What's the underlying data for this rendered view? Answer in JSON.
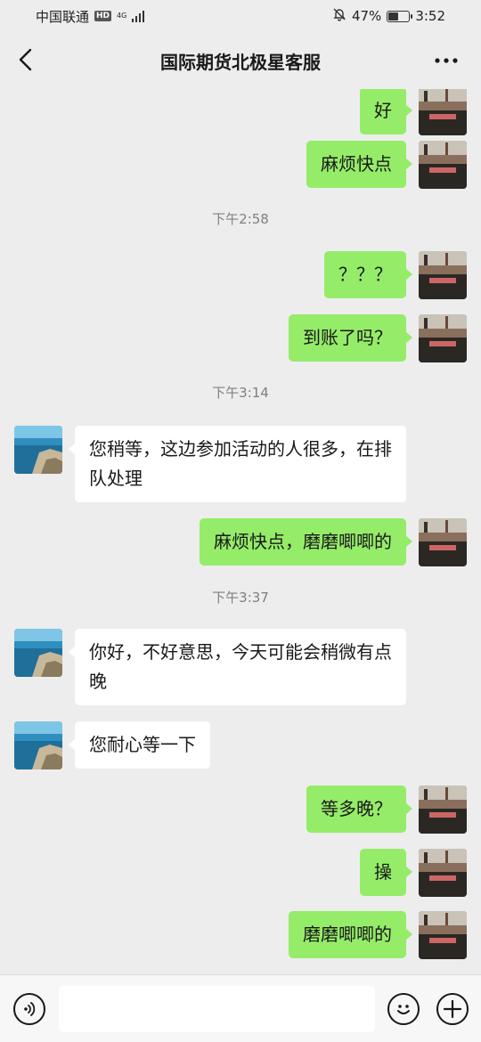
{
  "status_bar": {
    "carrier": "中国联通",
    "hd_badge": "HD",
    "network": "4G",
    "battery_percent": "47%",
    "battery_level": 0.47,
    "time": "3:52",
    "icons": [
      "mute-bell-icon",
      "signal-icon",
      "battery-icon"
    ]
  },
  "nav": {
    "title": "国际期货北极星客服",
    "back_icon": "chevron-left-icon",
    "more_icon": "more-dots-icon"
  },
  "chat": {
    "messages": [
      {
        "dir": "out",
        "text": "好"
      },
      {
        "dir": "out",
        "text": "麻烦快点"
      },
      {
        "type": "time",
        "text": "下午2:58"
      },
      {
        "dir": "out",
        "text": "？？？"
      },
      {
        "dir": "out",
        "text": "到账了吗？"
      },
      {
        "type": "time",
        "text": "下午3:14"
      },
      {
        "dir": "in",
        "text": "您稍等，这边参加活动的人很多，在排队处理"
      },
      {
        "dir": "out",
        "text": "麻烦快点，磨磨唧唧的"
      },
      {
        "type": "time",
        "text": "下午3:37"
      },
      {
        "dir": "in",
        "text": "你好，不好意思，今天可能会稍微有点晚"
      },
      {
        "dir": "in",
        "text": "您耐心等一下"
      },
      {
        "dir": "out",
        "text": "等多晚？"
      },
      {
        "dir": "out",
        "text": "操"
      },
      {
        "dir": "out",
        "text": "磨磨唧唧的"
      }
    ]
  },
  "input_bar": {
    "input_value": "",
    "voice_icon": "voice-icon",
    "emoji_icon": "emoji-icon",
    "plus_icon": "plus-icon"
  },
  "colors": {
    "background": "#ededed",
    "outgoing_bubble": "#95ec69",
    "incoming_bubble": "#ffffff"
  }
}
